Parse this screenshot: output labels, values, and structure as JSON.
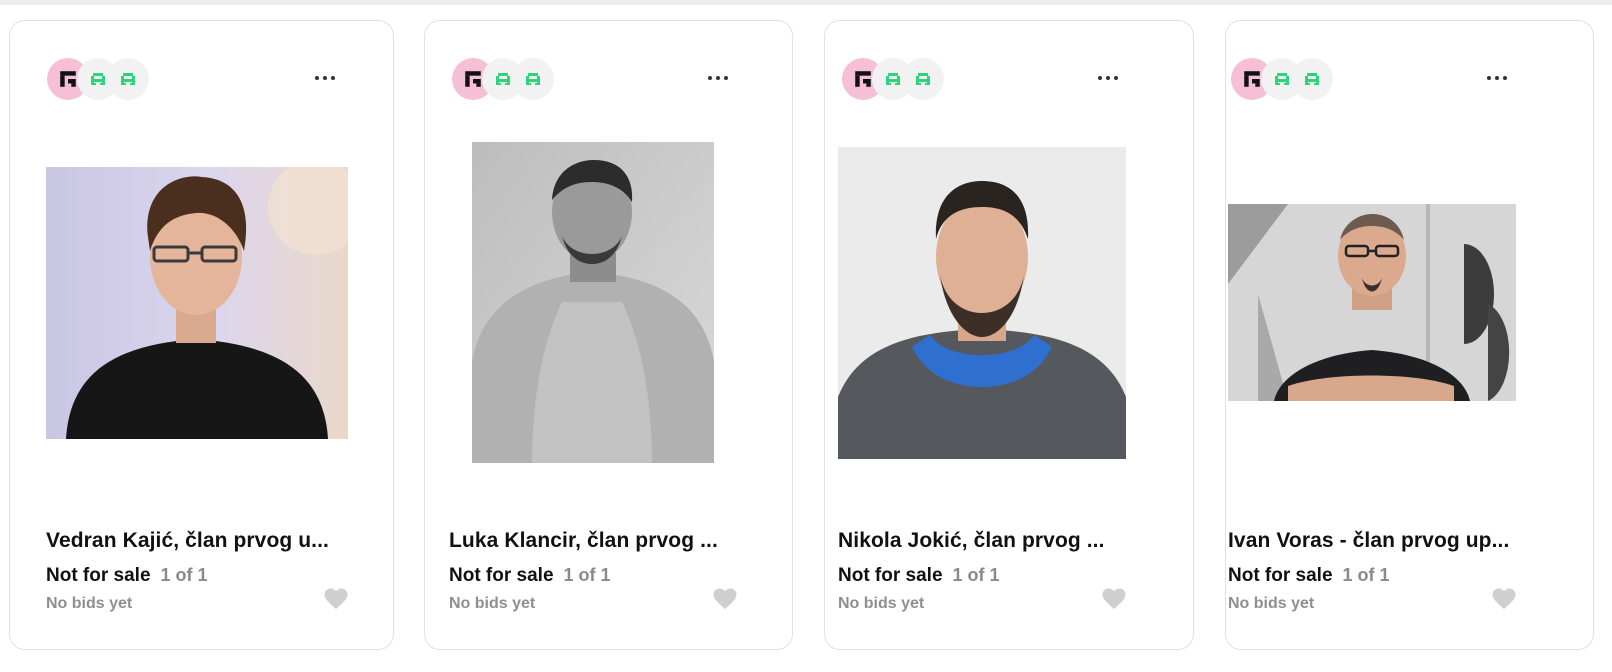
{
  "colors": {
    "accent_pink": "#f7bfd6",
    "accent_green": "#2fd37a",
    "muted": "#8f8f8f"
  },
  "icons": {
    "more": "more-horizontal-icon",
    "like": "heart-icon",
    "brand": "pixel-logo-icon"
  },
  "cards": [
    {
      "title": "Vedran Kajić, član prvog u...",
      "sale_status": "Not for sale",
      "edition": "1 of 1",
      "bids": "No bids yet"
    },
    {
      "title": "Luka Klancir, član prvog ...",
      "sale_status": "Not for sale",
      "edition": "1 of 1",
      "bids": "No bids yet"
    },
    {
      "title": "Nikola Jokić, član prvog ...",
      "sale_status": "Not for sale",
      "edition": "1 of 1",
      "bids": "No bids yet"
    },
    {
      "title": "Ivan Voras - član prvog up...",
      "sale_status": "Not for sale",
      "edition": "1 of 1",
      "bids": "No bids yet"
    }
  ]
}
